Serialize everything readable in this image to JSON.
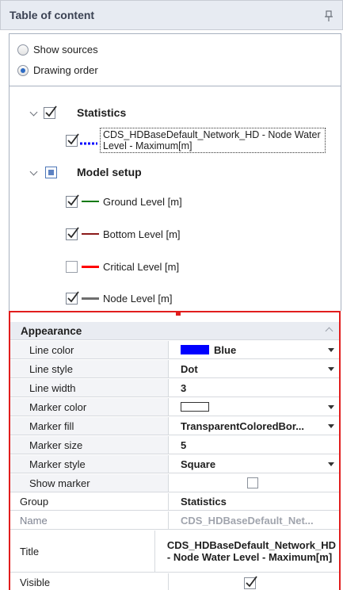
{
  "panel": {
    "title": "Table of content"
  },
  "view_mode": {
    "options": [
      {
        "label": "Show sources",
        "selected": false
      },
      {
        "label": "Drawing order",
        "selected": true
      }
    ]
  },
  "tree": {
    "groups": [
      {
        "title": "Statistics",
        "checked": true,
        "layers": [
          {
            "label": "CDS_HDBaseDefault_Network_HD - Node Water Level - Maximum[m]",
            "checked": true,
            "line_color": "#0000ff",
            "line_style": "dot",
            "selected": true
          }
        ]
      },
      {
        "title": "Model setup",
        "checked": "partial",
        "layers": [
          {
            "label": "Ground Level [m]",
            "checked": true,
            "line_color": "#0a7a0a",
            "line_style": "solid"
          },
          {
            "label": "Bottom Level [m]",
            "checked": true,
            "line_color": "#8b1a1a",
            "line_style": "solid"
          },
          {
            "label": "Critical Level [m]",
            "checked": false,
            "line_color": "#ff0000",
            "line_style": "solid"
          },
          {
            "label": "Node Level [m]",
            "checked": true,
            "line_color": "#6e6e6e",
            "line_style": "solid"
          }
        ]
      }
    ]
  },
  "properties": {
    "category": "Appearance",
    "appearance": [
      {
        "name": "Line color",
        "value": "Blue",
        "swatch": "#0000ff",
        "dropdown": true
      },
      {
        "name": "Line style",
        "value": "Dot",
        "dropdown": true
      },
      {
        "name": "Line width",
        "value": "3",
        "dropdown": false
      },
      {
        "name": "Marker color",
        "value": "",
        "swatch": "#ffffff",
        "dropdown": true
      },
      {
        "name": "Marker fill",
        "value": "TransparentColoredBor...",
        "dropdown": true
      },
      {
        "name": "Marker size",
        "value": "5",
        "dropdown": false
      },
      {
        "name": "Marker style",
        "value": "Square",
        "dropdown": true
      },
      {
        "name": "Show marker",
        "value": false,
        "type": "checkbox"
      }
    ],
    "general": [
      {
        "name": "Group",
        "value": "Statistics"
      },
      {
        "name": "Name",
        "value": "CDS_HDBaseDefault_Net...",
        "readonly": true
      },
      {
        "name": "Title",
        "value": "CDS_HDBaseDefault_Network_HD - Node Water Level - Maximum[m]"
      },
      {
        "name": "Visible",
        "value": true,
        "type": "checkbox"
      }
    ]
  }
}
